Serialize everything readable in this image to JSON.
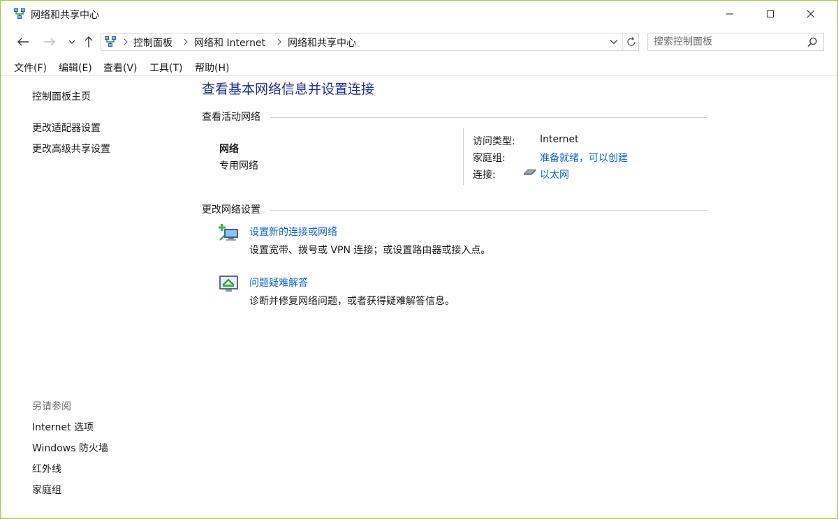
{
  "window": {
    "title": "网络和共享中心",
    "controls": {
      "minimize": "minimize",
      "maximize": "maximize",
      "close": "close"
    }
  },
  "address": {
    "crumbs": [
      "控制面板",
      "网络和 Internet",
      "网络和共享中心"
    ]
  },
  "search": {
    "placeholder": "搜索控制面板"
  },
  "menu": {
    "items": [
      "文件(F)",
      "编辑(E)",
      "查看(V)",
      "工具(T)",
      "帮助(H)"
    ]
  },
  "sidebar": {
    "links": [
      "控制面板主页",
      "更改适配器设置",
      "更改高级共享设置"
    ],
    "see_also_title": "另请参阅",
    "see_also": [
      "Internet 选项",
      "Windows 防火墙",
      "红外线",
      "家庭组"
    ]
  },
  "main": {
    "title": "查看基本网络信息并设置连接",
    "active_networks_heading": "查看活动网络",
    "network": {
      "name": "网络",
      "category": "专用网络"
    },
    "properties": {
      "access_type_label": "访问类型:",
      "access_type_value": "Internet",
      "homegroup_label": "家庭组:",
      "homegroup_value": "准备就绪，可以创建",
      "connections_label": "连接:",
      "connections_value": "以太网"
    },
    "change_settings_heading": "更改网络设置",
    "tasks": [
      {
        "title": "设置新的连接或网络",
        "desc": "设置宽带、拨号或 VPN 连接；或设置路由器或接入点。"
      },
      {
        "title": "问题疑难解答",
        "desc": "诊断并修复网络问题，或者获得疑难解答信息。"
      }
    ]
  },
  "colors": {
    "title_blue": "#1e3287",
    "link_blue": "#0f64c8",
    "window_border": "#9acd3e"
  }
}
